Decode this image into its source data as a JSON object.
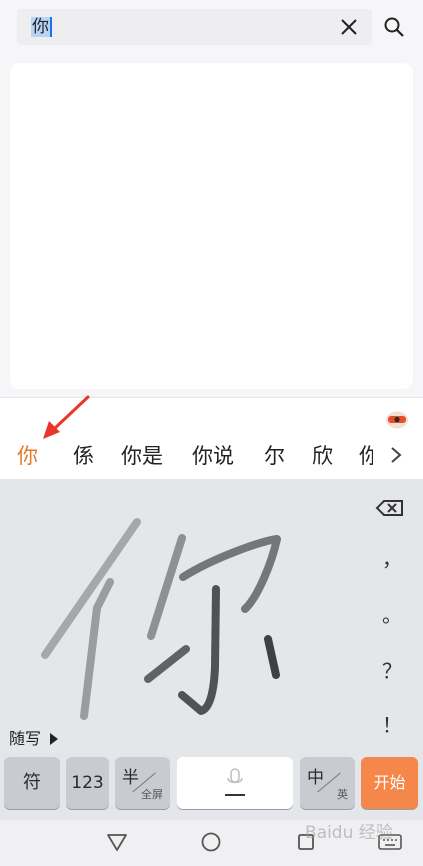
{
  "search": {
    "query": "你",
    "clear_icon": "close-icon",
    "search_icon": "search-icon"
  },
  "candidates": {
    "items": [
      "你",
      "係",
      "你是",
      "你说",
      "尔",
      "欣"
    ],
    "partial": "你",
    "more_icon": "chevron-right-icon",
    "logo_icon": "ime-logo-icon",
    "highlight_color": "#e47a2c"
  },
  "annotation": {
    "arrow_color": "#e8362b"
  },
  "handwriting": {
    "strokes_icon": "handwritten-character-strokes",
    "mode_label": "随写"
  },
  "side_keys": {
    "backspace_icon": "backspace-icon",
    "comma": "，",
    "period": "。",
    "question": "？",
    "exclaim": "！"
  },
  "bottom_keys": {
    "symbol": "符",
    "numbers": "123",
    "half_main": "半",
    "half_sub": "全屏",
    "space_icon": "microphone-icon",
    "lang_main": "中",
    "lang_sub": "英",
    "go": "开始",
    "go_color": "#f5874a"
  },
  "navbar": {
    "back_icon": "triangle-back-icon",
    "home_icon": "circle-home-icon",
    "recent_icon": "square-recents-icon",
    "keyboard_icon": "keyboard-icon",
    "watermark": "Baidu 经验"
  }
}
